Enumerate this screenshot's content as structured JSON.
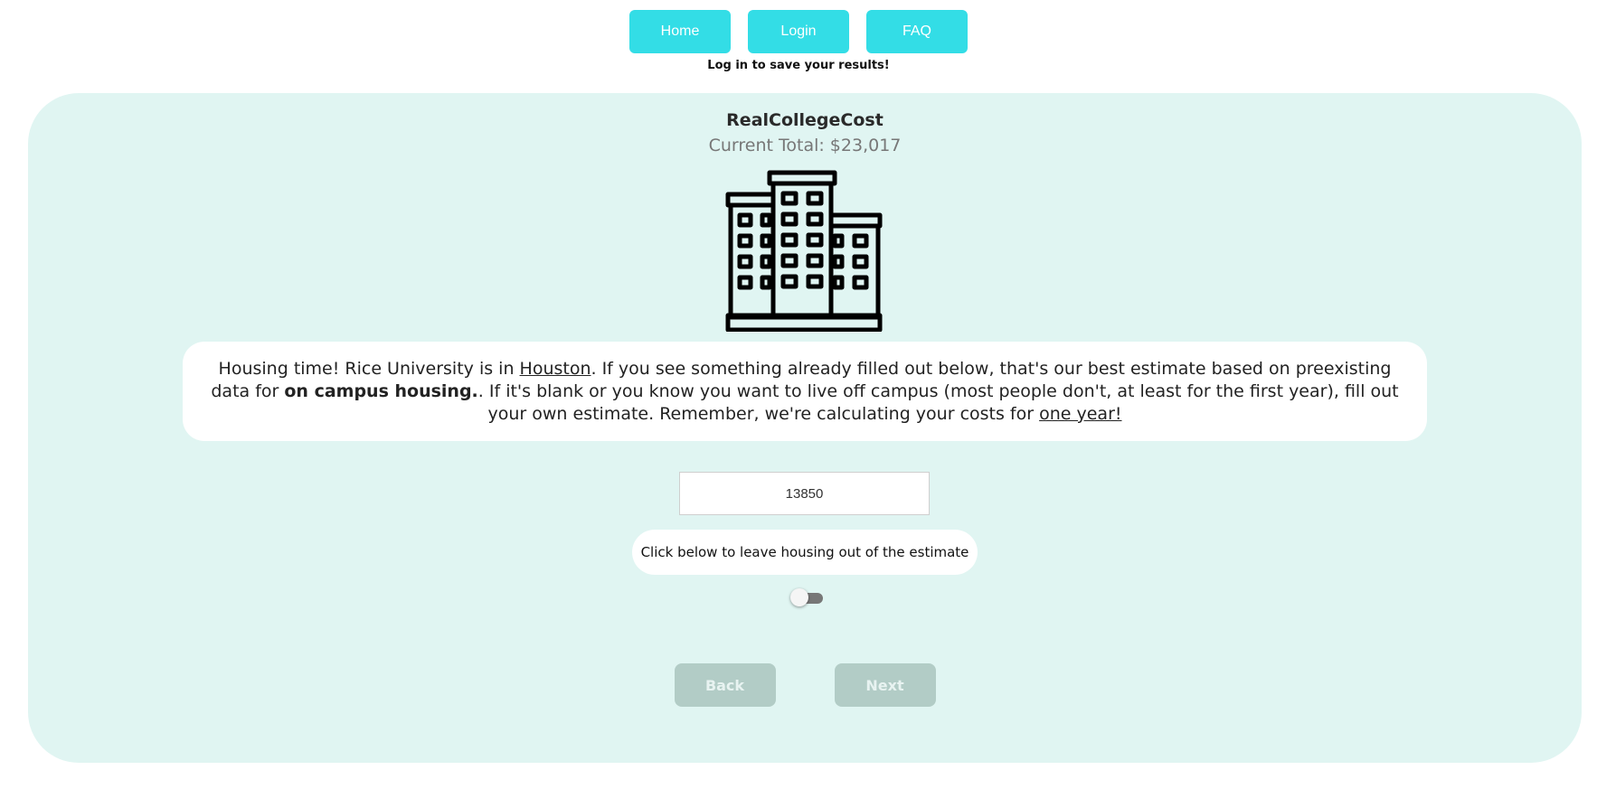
{
  "nav": {
    "home": "Home",
    "login": "Login",
    "faq": "FAQ",
    "login_note": "Log in to save your results!"
  },
  "header": {
    "title": "RealCollegeCost",
    "total": "Current Total: $23,017"
  },
  "info": {
    "part1": "Housing time! Rice University is in ",
    "city": "Houston",
    "part2": ". If you see something already filled out below, that's our best estimate based on preexisting data for ",
    "bold": "on campus housing.",
    "part3": ". If it's blank or you know you want to live off campus (most people don't, at least for the first year), fill out your own estimate. Remember, we're calculating your costs for ",
    "underline_end": "one year!"
  },
  "housing_input": {
    "value": "13850"
  },
  "toggle": {
    "label": "Click below to leave housing out of the estimate",
    "checked": false
  },
  "buttons": {
    "back": "Back",
    "next": "Next"
  },
  "colors": {
    "nav_button": "#33dde6",
    "panel_bg": "#e0f5f2",
    "disabled_button": "#b2ccc6"
  },
  "icons": {
    "illustration": "apartment-building-icon"
  }
}
